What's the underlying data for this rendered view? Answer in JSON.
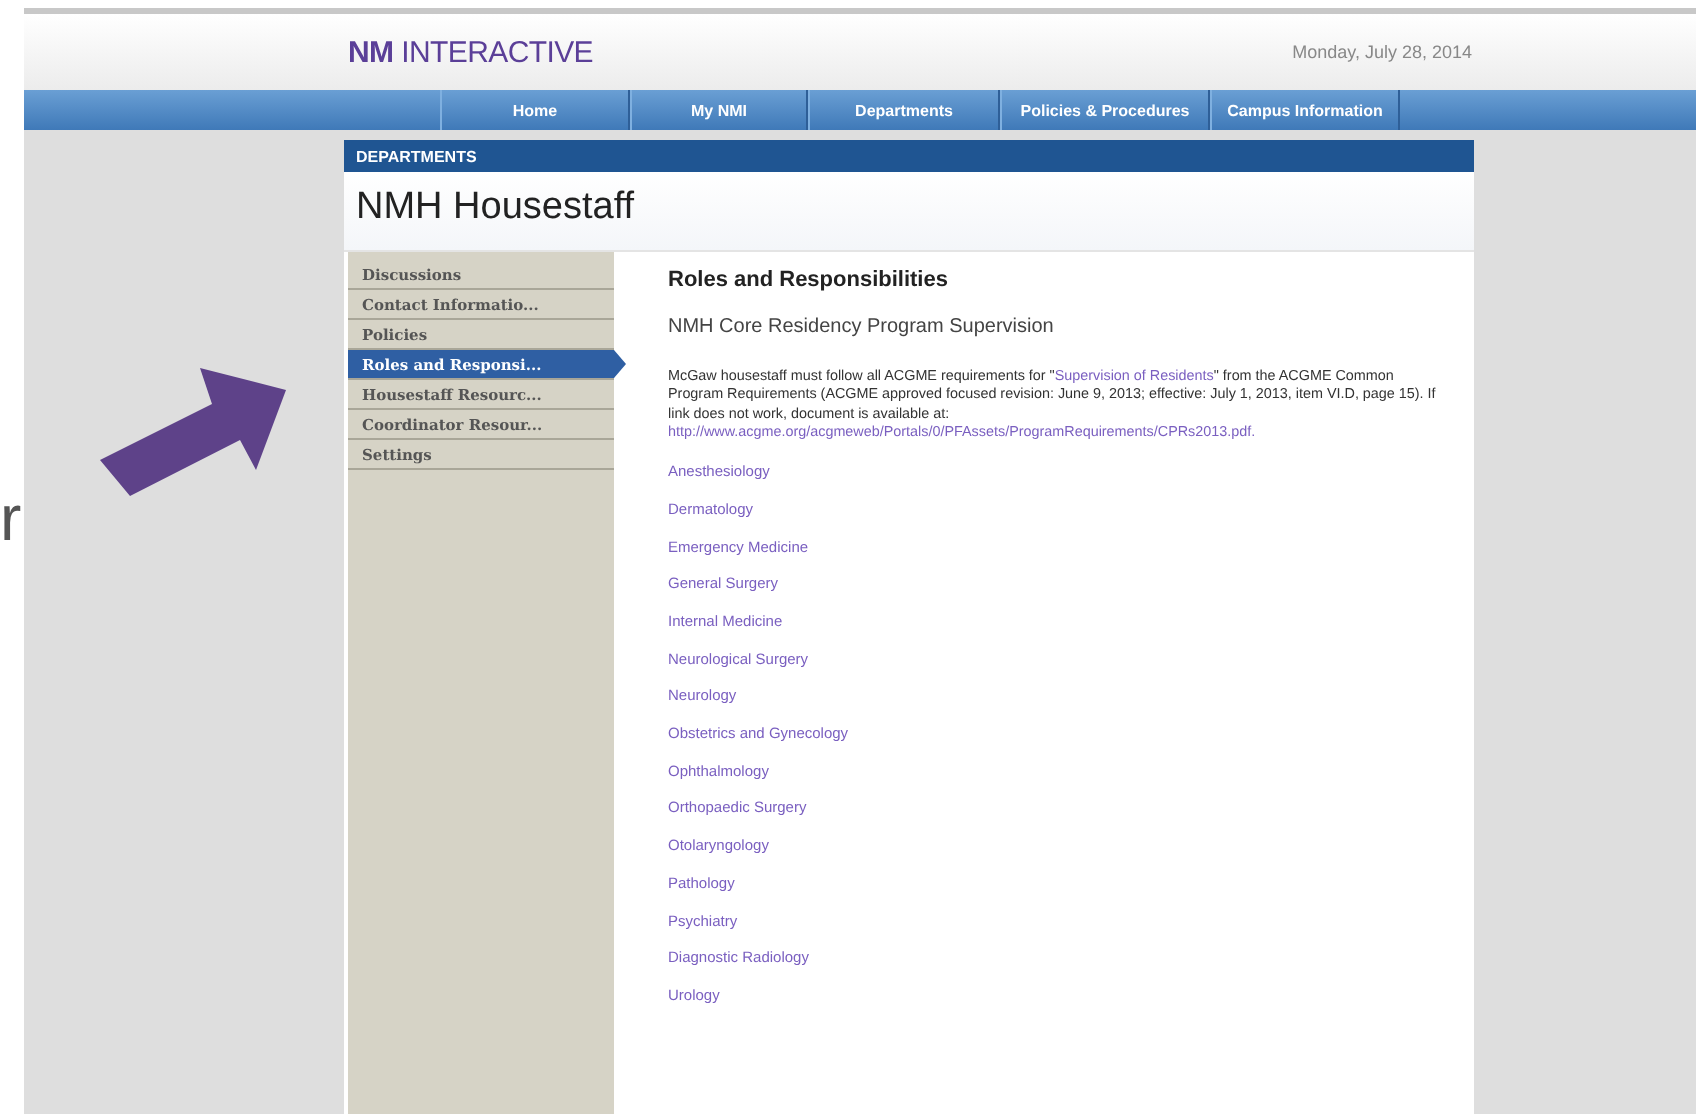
{
  "slide_text": "r",
  "header": {
    "logo_bold": "NM",
    "logo_rest": "INTERACTIVE",
    "date": "Monday, July 28, 2014"
  },
  "nav": [
    {
      "label": "Home"
    },
    {
      "label": "My NMI"
    },
    {
      "label": "Departments"
    },
    {
      "label": "Policies & Procedures"
    },
    {
      "label": "Campus Information"
    }
  ],
  "section_bar": "DEPARTMENTS",
  "page_title": "NMH Housestaff",
  "sidebar": {
    "items": [
      {
        "label": "Discussions",
        "selected": false
      },
      {
        "label": "Contact Informatio...",
        "selected": false
      },
      {
        "label": "Policies",
        "selected": false
      },
      {
        "label": "Roles and Responsi...",
        "selected": true
      },
      {
        "label": "Housestaff Resourc...",
        "selected": false
      },
      {
        "label": "Coordinator Resour...",
        "selected": false
      },
      {
        "label": "Settings",
        "selected": false
      }
    ]
  },
  "content": {
    "heading": "Roles and Responsibilities",
    "subheading": "NMH Core Residency Program Supervision",
    "intro_before": "McGaw housestaff must follow all ACGME requirements for \"",
    "intro_link": "Supervision of Residents",
    "intro_after": "\" from the ACGME Common Program Requirements (ACGME approved focused revision: June 9, 2013; effective: July 1, 2013, item VI.D, page 15). If link does not work, document is available at:",
    "url": "http://www.acgme.org/acgmeweb/Portals/0/PFAssets/ProgramRequirements/CPRs2013.pdf.",
    "links": [
      "Anesthesiology",
      "Dermatology",
      "Emergency Medicine",
      "General Surgery",
      "Internal Medicine",
      "Neurological Surgery",
      "Neurology",
      "Obstetrics and Gynecology",
      "Ophthalmology",
      "Orthopaedic Surgery",
      "Otolaryngology",
      "Pathology",
      "Psychiatry",
      "Diagnostic Radiology",
      "Urology"
    ]
  }
}
